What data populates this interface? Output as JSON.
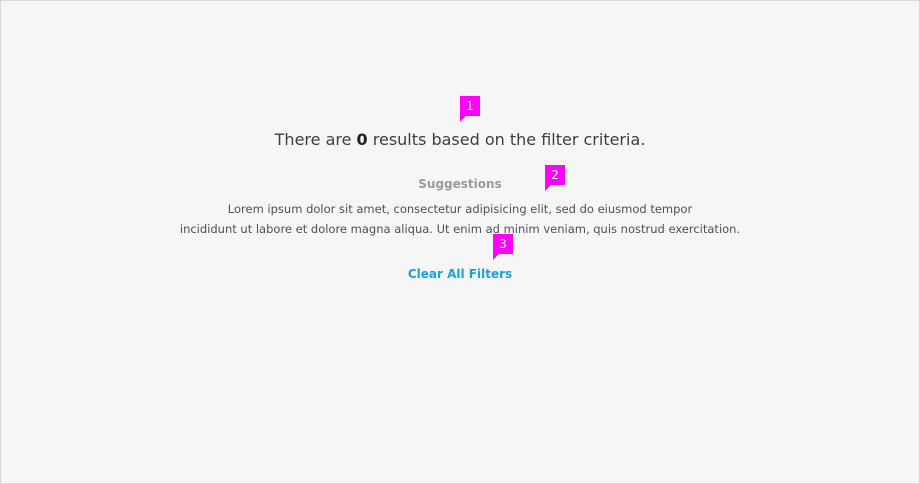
{
  "empty_state": {
    "headline_prefix": "There are ",
    "result_count": "0",
    "headline_suffix": " results based on the filter criteria.",
    "suggestions_heading": "Suggestions",
    "suggestions_line_1": "Lorem ipsum dolor sit amet, consectetur adipisicing elit, sed do eiusmod tempor",
    "suggestions_line_2": "incididunt ut labore et dolore magna aliqua. Ut enim ad minim veniam, quis nostrud exercitation.",
    "clear_filters_label": "Clear All Filters"
  },
  "annotations": [
    "1",
    "2",
    "3"
  ],
  "colors": {
    "background": "#f6f6f6",
    "link": "#1aa3cc",
    "marker": "#ff00ff",
    "heading_muted": "#9a9a9a"
  }
}
